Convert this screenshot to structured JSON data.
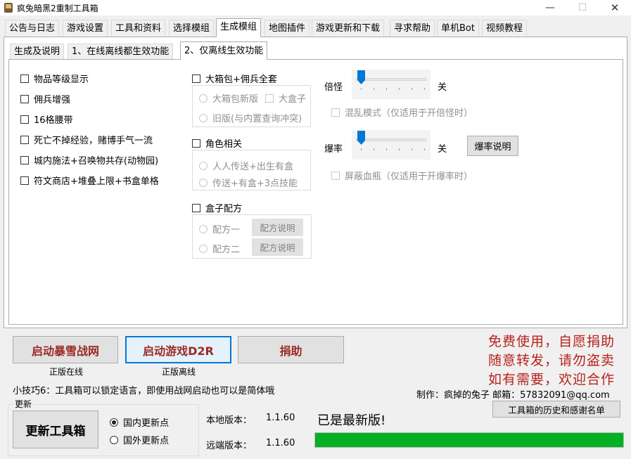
{
  "window": {
    "title": "疯兔暗黑2重制工具箱",
    "minimize": "—",
    "maximize": "☐",
    "close": "✕"
  },
  "main_tabs": [
    "公告与日志",
    "游戏设置",
    "工具和资料",
    "选择模组",
    "生成模组",
    "地图插件",
    "游戏更新和下载",
    "寻求帮助",
    "单机Bot",
    "视频教程"
  ],
  "main_tab_active": "生成模组",
  "sub_tabs": [
    "生成及说明",
    "1、在线离线都生效功能",
    "2、仅离线生效功能"
  ],
  "sub_tab_active": "2、仅离线生效功能",
  "left_options": [
    "物品等级显示",
    "佣兵增强",
    "16格腰带",
    "死亡不掉经验，赌博手气一流",
    "城内施法+召唤物共存(动物园)",
    "符文商店+堆叠上限+书盒单格"
  ],
  "big_box": {
    "label": "大箱包+佣兵全套",
    "options": [
      "大箱包新版",
      "大盒子",
      "旧版(与内置查询冲突)"
    ]
  },
  "character": {
    "label": "角色相关",
    "options": [
      "人人传送+出生有盒",
      "传送+有盒+3点技能"
    ]
  },
  "recipe": {
    "label": "盒子配方",
    "options": [
      "配方一",
      "配方二"
    ],
    "help_label": "配方说明"
  },
  "multiplier": {
    "label": "倍怪",
    "state": "关",
    "level": 0,
    "chaos_label": "混乱模式（仅适用于开倍怪时）"
  },
  "droprate": {
    "label": "爆率",
    "state": "关",
    "level": 0,
    "help_button": "爆率说明",
    "hide_potion_label": "屏蔽血瓶（仅适用于开爆率时）"
  },
  "launch": {
    "battlenet": "启动暴雪战网",
    "battlenet_caption": "正版在线",
    "d2r": "启动游戏D2R",
    "d2r_caption": "正版离线",
    "donate": "捐助"
  },
  "promo": [
    "免费使用，自愿捐助",
    "随意转发，请勿盗卖",
    "如有需要，欢迎合作"
  ],
  "tip": "小技巧6：工具箱可以锁定语言，即使用战网启动也可以是简体哦",
  "author": "制作：疯掉的兔子 邮箱：57832091@qq.com",
  "update": {
    "group_label": "更新",
    "button": "更新工具箱",
    "domestic": "国内更新点",
    "overseas": "国外更新点",
    "selected": "国内更新点",
    "local_label": "本地版本：",
    "local_version": "1.1.60",
    "remote_label": "远端版本：",
    "remote_version": "1.1.60",
    "status": "已是最新版!",
    "progress": 1.0,
    "history_button": "工具箱的历史和感谢名单"
  },
  "colors": {
    "accent": "#0078d7",
    "promo_red": "#b8221b",
    "launch_text": "#9b2a25",
    "progress_green": "#06b025"
  }
}
